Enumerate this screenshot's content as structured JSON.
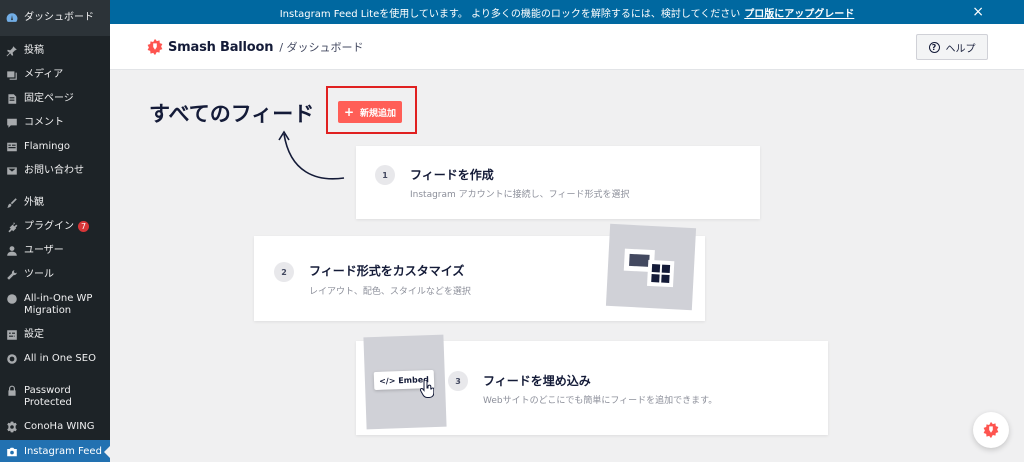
{
  "sidebar": {
    "dashboard": "ダッシュボード",
    "items": [
      {
        "label": "投稿",
        "icon": "pin-icon"
      },
      {
        "label": "メディア",
        "icon": "media-icon"
      },
      {
        "label": "固定ページ",
        "icon": "page-icon"
      },
      {
        "label": "コメント",
        "icon": "comment-icon"
      },
      {
        "label": "Flamingo",
        "icon": "flamingo-icon"
      },
      {
        "label": "お問い合わせ",
        "icon": "mail-icon"
      },
      {
        "label": "外観",
        "icon": "brush-icon"
      },
      {
        "label": "プラグイン",
        "icon": "plugin-icon",
        "badge": "7"
      },
      {
        "label": "ユーザー",
        "icon": "user-icon"
      },
      {
        "label": "ツール",
        "icon": "wrench-icon"
      },
      {
        "label": "All-in-One WP Migration",
        "icon": "migration-icon"
      },
      {
        "label": "設定",
        "icon": "settings-icon"
      },
      {
        "label": "All in One SEO",
        "icon": "seo-icon"
      },
      {
        "label": "Password Protected",
        "icon": "lock-icon"
      },
      {
        "label": "ConoHa WING",
        "icon": "gear-icon"
      },
      {
        "label": "Instagram Feed",
        "icon": "camera-icon"
      }
    ]
  },
  "notice": {
    "text": "Instagram Feed Liteを使用しています。 より多くの機能のロックを解除するには、検討してください",
    "link": "プロ版にアップグレード",
    "close": "×"
  },
  "header": {
    "brand": "Smash Balloon",
    "crumb": "/ ダッシュボード",
    "help": "ヘルプ"
  },
  "main": {
    "title": "すべてのフィード",
    "add_new": "新規追加",
    "add_plus": "+"
  },
  "steps": [
    {
      "num": "1",
      "title": "フィードを作成",
      "desc": "Instagram アカウントに接続し、フィード形式を選択"
    },
    {
      "num": "2",
      "title": "フィード形式をカスタマイズ",
      "desc": "レイアウト、配色、スタイルなどを選択"
    },
    {
      "num": "3",
      "title": "フィードを埋め込み",
      "desc": "Webサイトのどこにでも簡単にフィードを追加できます。"
    }
  ],
  "embed_label": "</> Embed",
  "colors": {
    "sidebar_bg": "#1d2327",
    "active_bg": "#2271b1",
    "notice_bg": "#0068a0",
    "accent": "#ff5e57",
    "highlight": "#e02020"
  }
}
